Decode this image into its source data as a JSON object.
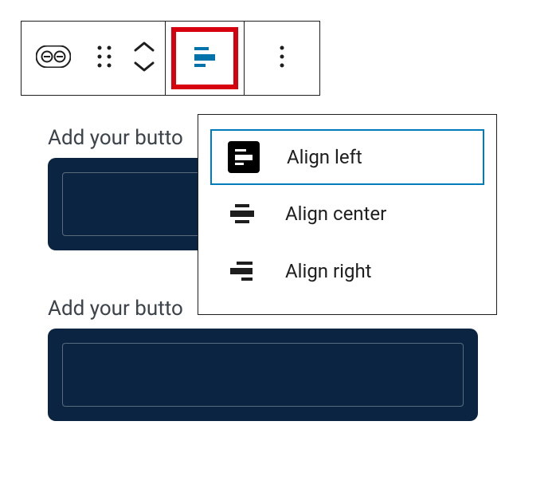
{
  "toolbar": {
    "block_type": "Button",
    "drag": "Drag",
    "move": "Move up/down",
    "align": "Change alignment",
    "more": "More options"
  },
  "align_menu": {
    "items": [
      {
        "label": "Align left"
      },
      {
        "label": "Align center"
      },
      {
        "label": "Align right"
      }
    ]
  },
  "content": {
    "label1": "Add your butto",
    "label2": "Add your butto"
  }
}
